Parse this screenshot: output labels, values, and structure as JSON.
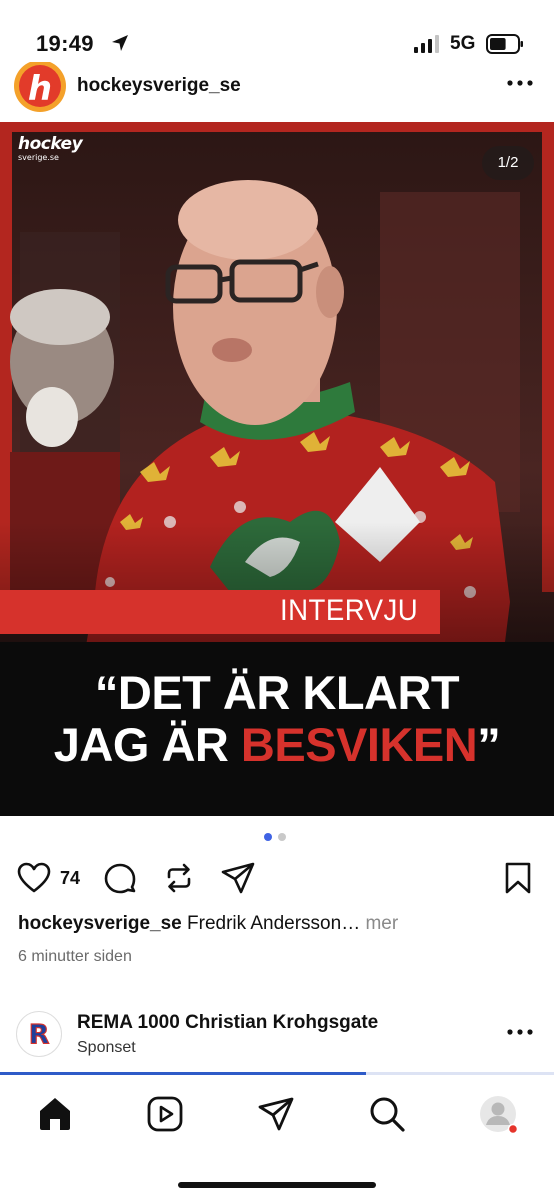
{
  "status_bar": {
    "time": "19:49",
    "network": "5G",
    "battery_level": 0.6
  },
  "post": {
    "username": "hockeysverige_se",
    "image": {
      "brand_line1": "hockey",
      "brand_line2": "sverige.se",
      "counter": "1/2",
      "banner": "INTERVJU",
      "headline_line1": "“DET ÄR KLART",
      "headline_line2_a": "JAG ÄR ",
      "headline_line2_b": "BESVIKEN",
      "headline_line2_c": "”"
    },
    "carousel": {
      "pages": 2,
      "active": 1
    },
    "likes": "74",
    "caption_user": "hockeysverige_se",
    "caption_text": " Fredrik Andersson…",
    "caption_more": " mer",
    "timestamp": "6 minutter siden"
  },
  "sponsored": {
    "name": "REMA 1000 Christian Krohgsgate",
    "subtitle": "Sponset",
    "avatar_letter": "R"
  },
  "progress": {
    "fraction": 0.66
  },
  "bottom_nav": [
    "home-icon",
    "reels-icon",
    "send-icon",
    "search-icon",
    "profile-icon"
  ],
  "colors": {
    "accent_red": "#d6322c",
    "blue": "#3f63e4",
    "brand_orange": "#f4a12a"
  }
}
